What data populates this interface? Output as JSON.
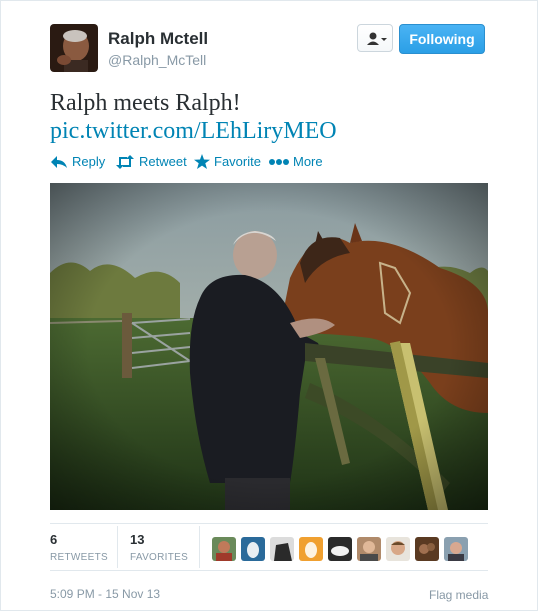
{
  "user": {
    "name": "Ralph Mctell",
    "handle": "@Ralph_McTell"
  },
  "follow_button": "Following",
  "tweet": {
    "text": "Ralph meets Ralph!",
    "link": "pic.twitter.com/LEhLiryMEO"
  },
  "actions": [
    {
      "label": "Reply",
      "icon": "reply-icon"
    },
    {
      "label": "Retweet",
      "icon": "retweet-icon"
    },
    {
      "label": "Favorite",
      "icon": "star-icon"
    },
    {
      "label": "More",
      "icon": "more-dots-icon"
    }
  ],
  "stats": {
    "retweets": {
      "count": "6",
      "label": "RETWEETS"
    },
    "favorites": {
      "count": "13",
      "label": "FAVORITES"
    }
  },
  "timestamp": "5:09 PM - 15 Nov 13",
  "flag_media": "Flag media",
  "colors": {
    "link": "#0084b4",
    "follow": "#2b9fe6",
    "muted": "#8899a6"
  }
}
